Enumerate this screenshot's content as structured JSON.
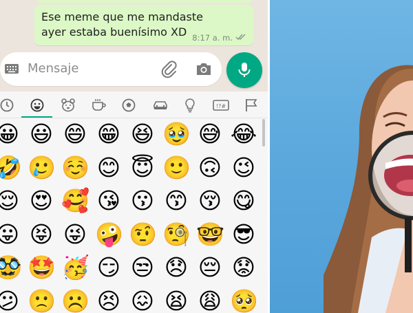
{
  "chat": {
    "message_text": "Ese meme que me mandaste ayer estaba buenísimo XD",
    "message_time": "8:17 a. m."
  },
  "input": {
    "placeholder": "Mensaje"
  },
  "icons": {
    "keyboard": "keyboard-icon",
    "attach": "paperclip-icon",
    "camera": "camera-icon",
    "mic": "microphone-icon",
    "read_receipt": "double-check-icon"
  },
  "emoji_tabs": [
    "recent",
    "smileys",
    "animals",
    "food",
    "activities",
    "travel",
    "objects",
    "symbols",
    "flags"
  ],
  "emoji_rows": [
    [
      "😀",
      "😃",
      "😄",
      "😁",
      "😆",
      "🥹",
      "😅",
      "😂"
    ],
    [
      "🤣",
      "🥲",
      "☺️",
      "😊",
      "😇",
      "🙂",
      "🙃",
      "😉"
    ],
    [
      "😌",
      "😍",
      "🥰",
      "😘",
      "😗",
      "😙",
      "😚",
      "😋"
    ],
    [
      "😛",
      "😝",
      "😜",
      "🤪",
      "🤨",
      "🧐",
      "🤓",
      "😎"
    ],
    [
      "🥸",
      "🤩",
      "🥳",
      "😏",
      "😒",
      "😞",
      "😔",
      "😟"
    ],
    [
      "😕",
      "🙁",
      "☹️",
      "😣",
      "😖",
      "😫",
      "😩",
      "🥺"
    ]
  ],
  "colors": {
    "accent": "#00a884",
    "outgoing_bubble": "#dcf8c6",
    "chat_background": "#ece5dd",
    "photo_background": "#5aa7dc"
  }
}
